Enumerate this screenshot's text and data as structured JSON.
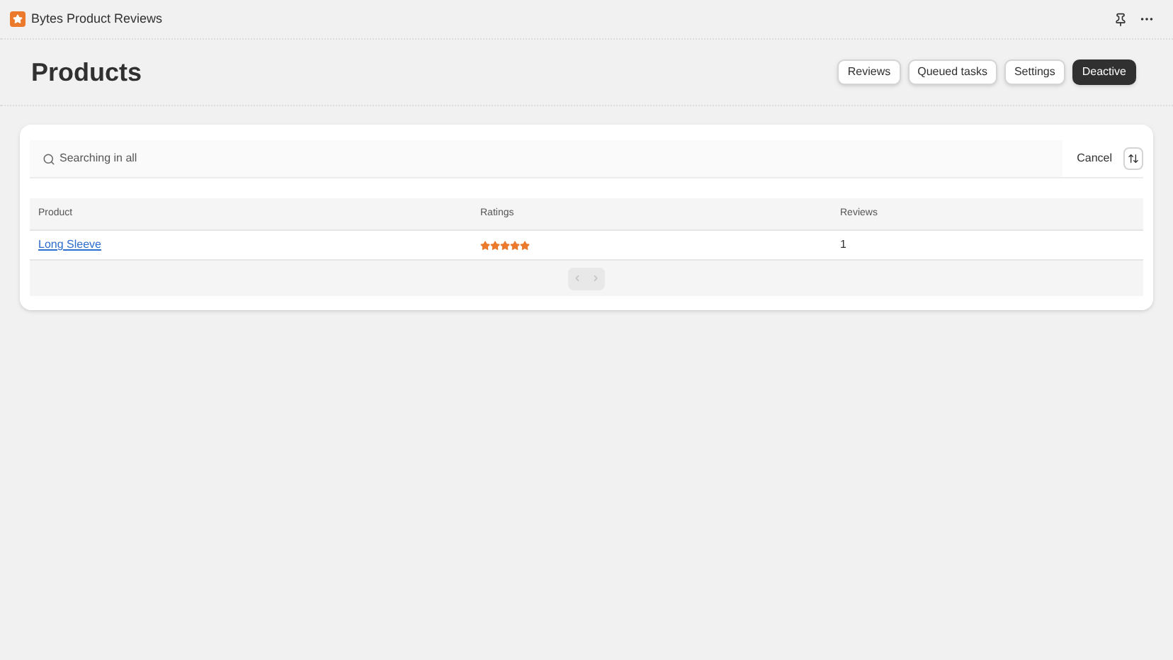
{
  "app_bar": {
    "title": "Bytes Product Reviews"
  },
  "page": {
    "title": "Products",
    "actions": [
      {
        "label": "Reviews",
        "kind": "secondary"
      },
      {
        "label": "Queued tasks",
        "kind": "secondary"
      },
      {
        "label": "Settings",
        "kind": "secondary"
      },
      {
        "label": "Deactive",
        "kind": "primary"
      }
    ]
  },
  "search": {
    "placeholder": "Searching in all",
    "cancel": "Cancel"
  },
  "table": {
    "columns": [
      "Product",
      "Ratings",
      "Reviews"
    ],
    "rows": [
      {
        "product": "Long Sleeve",
        "stars": 5,
        "reviews": "1"
      }
    ]
  },
  "pagination": {
    "previous_disabled": true,
    "next_disabled": true
  }
}
